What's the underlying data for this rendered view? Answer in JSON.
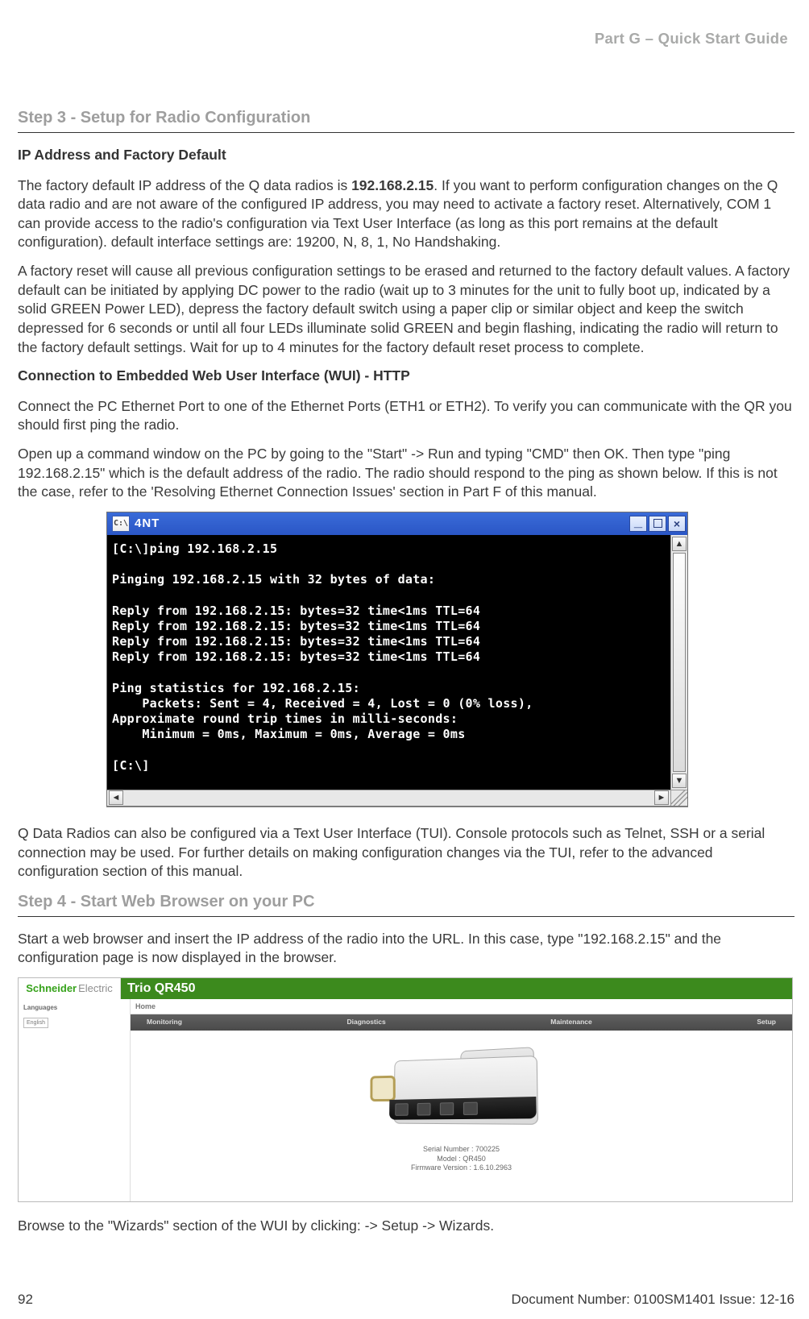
{
  "header": {
    "partLabel": "Part G – Quick Start Guide"
  },
  "step3": {
    "heading": "Step 3 - Setup for Radio Configuration",
    "sub1": "IP Address and Factory Default",
    "para1a": "The factory default IP address of the Q data radios is ",
    "ip": "192.168.2.15",
    "para1b": ". If you want to perform configuration changes on the Q data radio and are not aware of the configured IP address, you may need to activate a factory reset. Alternatively, COM 1 can provide access to the radio's configuration via Text User Interface (as long as this port remains at the default configuration). default interface settings are: 19200, N, 8, 1, No Handshaking.",
    "para2": "A factory reset will cause all previous configuration settings to be erased and returned to the factory default values. A factory default can be initiated by applying DC power to the radio (wait up to 3 minutes for the unit to fully boot up, indicated by a solid GREEN Power LED), depress the factory default switch using a paper clip or similar object and keep the switch depressed for 6 seconds or until all four LEDs illuminate solid GREEN and begin flashing, indicating the radio will return to the factory default settings. Wait for up to 4 minutes for the factory default reset process to complete.",
    "sub2": "Connection to Embedded Web User Interface (WUI) - HTTP",
    "para3": "Connect the PC Ethernet Port to one of the Ethernet Ports (ETH1 or ETH2). To verify you can communicate with the QR you should first ping the radio.",
    "para4": "Open up a command window on the PC by going to the \"Start\" -> Run and typing \"CMD\" then OK. Then type \"ping 192.168.2.15\" which is the default address of the radio. The radio should respond to the ping as shown below. If this is not the case, refer to the 'Resolving Ethernet Connection Issues' section in Part F of this manual.",
    "para5": "Q Data Radios can also be configured via a Text User Interface (TUI). Console protocols such as Telnet, SSH or a serial connection may be used. For further details on making configuration changes via the TUI, refer to the advanced configuration section of this manual."
  },
  "terminal": {
    "title": "4NT",
    "body": "[C:\\]ping 192.168.2.15\n\nPinging 192.168.2.15 with 32 bytes of data:\n\nReply from 192.168.2.15: bytes=32 time<1ms TTL=64\nReply from 192.168.2.15: bytes=32 time<1ms TTL=64\nReply from 192.168.2.15: bytes=32 time<1ms TTL=64\nReply from 192.168.2.15: bytes=32 time<1ms TTL=64\n\nPing statistics for 192.168.2.15:\n    Packets: Sent = 4, Received = 4, Lost = 0 (0% loss),\nApproximate round trip times in milli-seconds:\n    Minimum = 0ms, Maximum = 0ms, Average = 0ms\n\n[C:\\]",
    "btnMin": "_",
    "btnClose": "×"
  },
  "step4": {
    "heading": "Step 4 - Start Web Browser on your PC",
    "para1": "Start a web browser and insert the IP address of the radio into the URL. In this case, type \"192.168.2.15\" and the configuration page is now displayed in the browser.",
    "para2": "Browse to the \"Wizards\" section of the WUI by clicking: -> Setup -> Wizards."
  },
  "browser": {
    "brand1": "Schneider",
    "brand2": "Electric",
    "title": "Trio QR450",
    "home": "Home",
    "menu": [
      "Monitoring",
      "Diagnostics",
      "Maintenance",
      "Setup"
    ],
    "sideLang": "Languages",
    "langSel": "English",
    "devSerial": "Serial Number : 700225",
    "devModel": "Model : QR450",
    "devFw": "Firmware Version : 1.6.10.2963"
  },
  "footer": {
    "page": "92",
    "doc": "Document Number: 0100SM1401   Issue: 12-16"
  }
}
